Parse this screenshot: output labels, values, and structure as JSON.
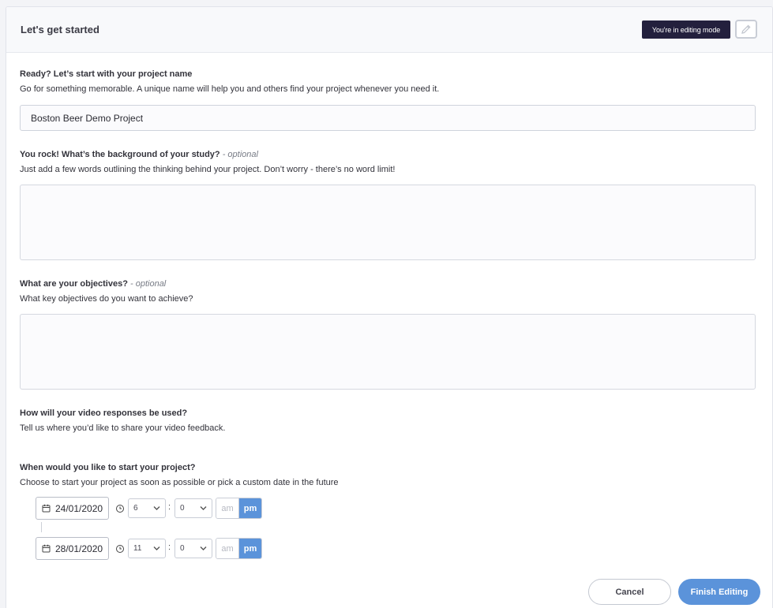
{
  "header": {
    "title": "Let's get started",
    "editing_badge": "You're in editing mode",
    "edit_icon": "pencil-icon"
  },
  "project_name": {
    "label": "Ready? Let’s start with your project name",
    "help": "Go for something memorable. A unique name will help you and others find your project whenever you need it.",
    "value": "Boston Beer Demo Project"
  },
  "background": {
    "label": "You rock! What’s the background of your study?",
    "optional": "- optional",
    "help": "Just add a few words outlining the thinking behind your project. Don’t worry - there’s no word limit!",
    "value": ""
  },
  "objectives": {
    "label": "What are your objectives?",
    "optional": "- optional",
    "help": "What key objectives do you want to achieve?",
    "value": ""
  },
  "usage": {
    "label": "How will your video responses be used?",
    "help": "Tell us where you’d like to share your video feedback."
  },
  "schedule": {
    "label": "When would you like to start your project?",
    "help": "Choose to start your project as soon as possible or pick a custom date in the future",
    "start": {
      "date": "24/01/2020",
      "hour": "6",
      "minute": "0",
      "am": "am",
      "pm": "pm",
      "selected": "pm"
    },
    "end": {
      "date": "28/01/2020",
      "hour": "11",
      "minute": "0",
      "am": "am",
      "pm": "pm",
      "selected": "pm"
    },
    "separator": ":"
  },
  "actions": {
    "cancel": "Cancel",
    "finish": "Finish Editing"
  },
  "colors": {
    "accent": "#5b93da",
    "badge": "#23203d"
  }
}
